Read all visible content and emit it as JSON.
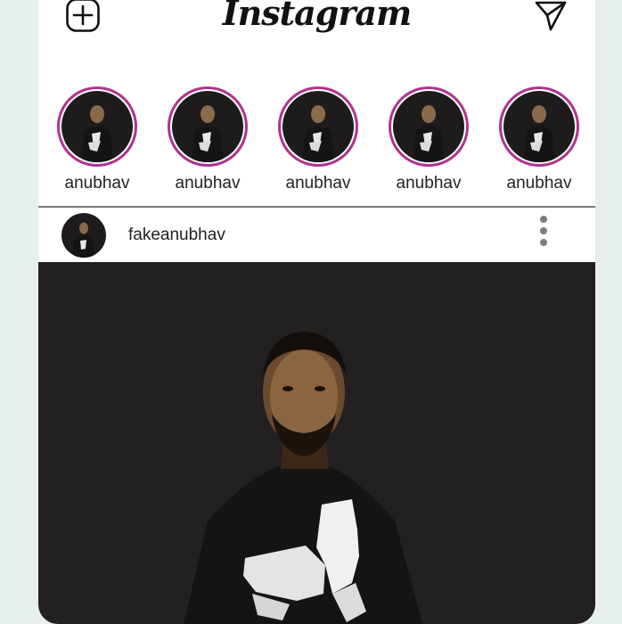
{
  "header": {
    "logo_text": "Instagram",
    "add_icon": "add-square-icon",
    "send_icon": "send-paper-plane-icon"
  },
  "stories": [
    {
      "username": "anubhav"
    },
    {
      "username": "anubhav"
    },
    {
      "username": "anubhav"
    },
    {
      "username": "anubhav"
    },
    {
      "username": "anubhav"
    }
  ],
  "post": {
    "username": "fakeanubhav",
    "menu_icon": "more-vertical-icon"
  },
  "colors": {
    "background": "#e6efe9",
    "story_ring": "#b0338f",
    "photo_bg": "#222021"
  }
}
